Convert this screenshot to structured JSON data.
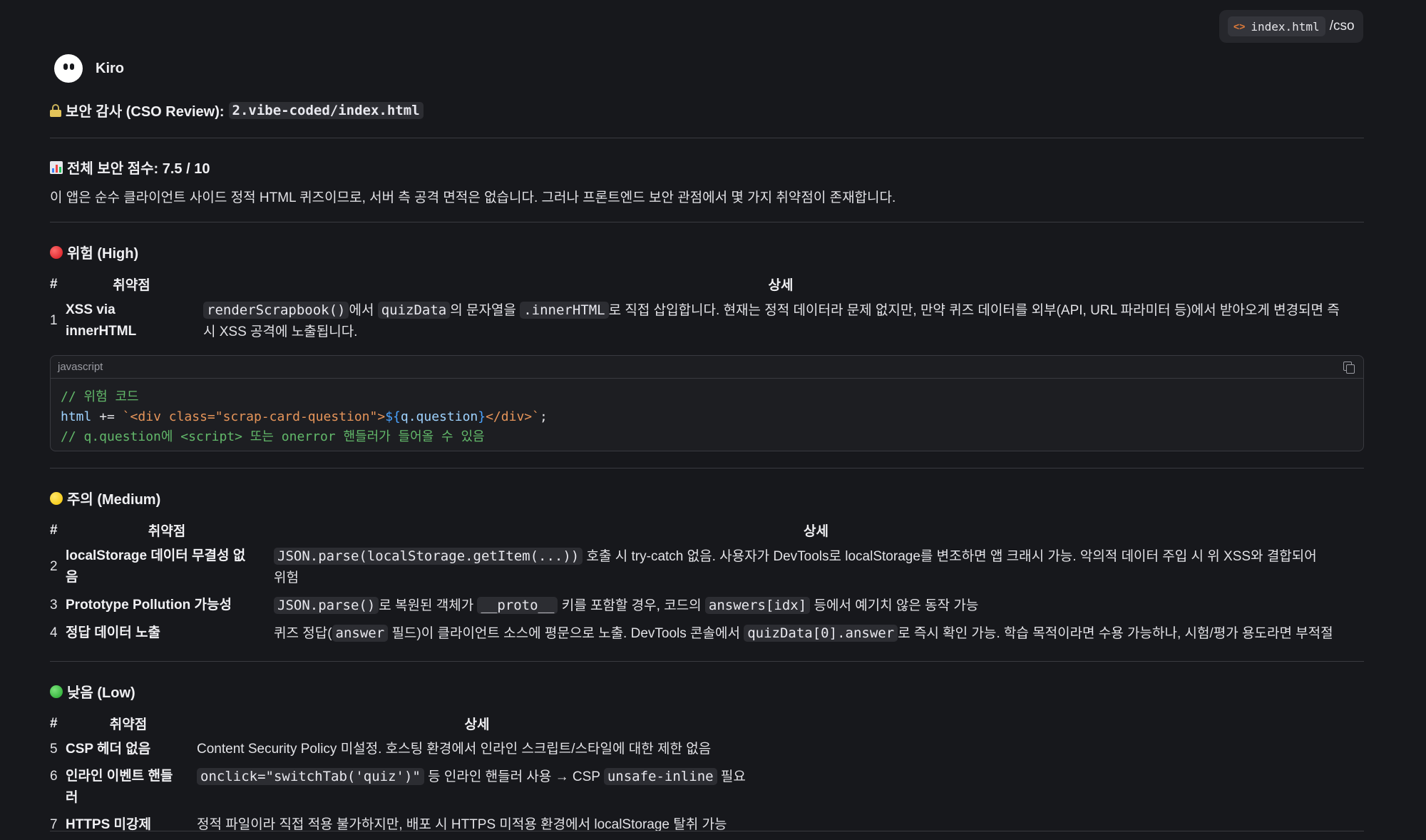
{
  "file_chip": {
    "filename": "index.html",
    "command": "/cso",
    "icon": "code-icon"
  },
  "agent": {
    "name": "Kiro",
    "icon": "ghost-avatar"
  },
  "title": {
    "prefix": "보안 감사 (CSO Review):",
    "path": "2.vibe-coded/index.html",
    "icon": "lock-icon"
  },
  "score": {
    "heading": "전체 보안 점수: 7.5 / 10",
    "icon": "bar-chart-icon",
    "summary": "이 앱은 순수 클라이언트 사이드 정적 HTML 퀴즈이므로, 서버 측 공격 면적은 없습니다. 그러나 프론트엔드 보안 관점에서 몇 가지 취약점이 존재합니다."
  },
  "high": {
    "heading": "위험 (High)",
    "color": "#d2141c",
    "headers": [
      "#",
      "취약점",
      "상세"
    ],
    "row1": {
      "num": "1",
      "name_a": "XSS via",
      "name_b": "innerHTML",
      "c1": "renderScrapbook()",
      "t1": "에서 ",
      "c2": "quizData",
      "t2": "의 문자열을 ",
      "c3": ".innerHTML",
      "t3": "로 직접 삽입합니다. 현재는 정적 데이터라 문제 없지만, 만약 퀴즈 데이터를 외부(API, URL 파라미터 등)에서 받아오게 변경되면 즉",
      "t4": "시 XSS 공격에 노출됩니다."
    },
    "code": {
      "lang": "javascript",
      "l1": "// 위험 코드",
      "l2_a": "html",
      "l2_b": " += ",
      "l2_c": "`<div class=\"scrap-card-question\">",
      "l2_d": "${",
      "l2_e": "q.question",
      "l2_f": "}",
      "l2_g": "</div>`",
      "l2_h": ";",
      "l3": "// q.question에 <script> 또는 onerror 핸들러가 들어올 수 있음"
    }
  },
  "medium": {
    "heading": "주의 (Medium)",
    "color": "#f2c200",
    "headers": [
      "#",
      "취약점",
      "상세"
    ],
    "rows": [
      {
        "num": "2",
        "name_a": "localStorage 데이터 무결성 없",
        "name_b": "음",
        "c1": "JSON.parse(localStorage.getItem(...))",
        "t1": " 호출 시 try-catch 없음. 사용자가 DevTools로 localStorage를 변조하면 앱 크래시 가능. 악의적 데이터 주입 시 위 XSS와 결합되어",
        "t2": "위험"
      },
      {
        "num": "3",
        "name": "Prototype Pollution 가능성",
        "c1": "JSON.parse()",
        "t1": "로 복원된 객체가 ",
        "c2": "__proto__",
        "t2": " 키를 포함할 경우, 코드의 ",
        "c3": "answers[idx]",
        "t3": " 등에서 예기치 않은 동작 가능"
      },
      {
        "num": "4",
        "name": "정답 데이터 노출",
        "t1": "퀴즈 정답(",
        "c1": "answer",
        "t2": " 필드)이 클라이언트 소스에 평문으로 노출. DevTools 콘솔에서 ",
        "c2": "quizData[0].answer",
        "t3": "로 즉시 확인 가능. 학습 목적이라면 수용 가능하나, 시험/평가 용도라면 부적절"
      }
    ]
  },
  "low": {
    "heading": "낮음 (Low)",
    "color": "#1fa52a",
    "headers": [
      "#",
      "취약점",
      "상세"
    ],
    "rows": [
      {
        "num": "5",
        "name": "CSP 헤더 없음",
        "t1": "Content Security Policy 미설정. 호스팅 환경에서 인라인 스크립트/스타일에 대한 제한 없음"
      },
      {
        "num": "6",
        "name": "인라인 이벤트 핸들러",
        "c1": "onclick=\"switchTab('quiz')\"",
        "t1": " 등 인라인 핸들러 사용 → CSP ",
        "c2": "unsafe-inline",
        "t2": " 필요"
      },
      {
        "num": "7",
        "name": "HTTPS 미강제",
        "t1": "정적 파일이라 직접 적용 불가하지만, 배포 시 HTTPS 미적용 환경에서 localStorage 탈취 가능"
      }
    ]
  }
}
